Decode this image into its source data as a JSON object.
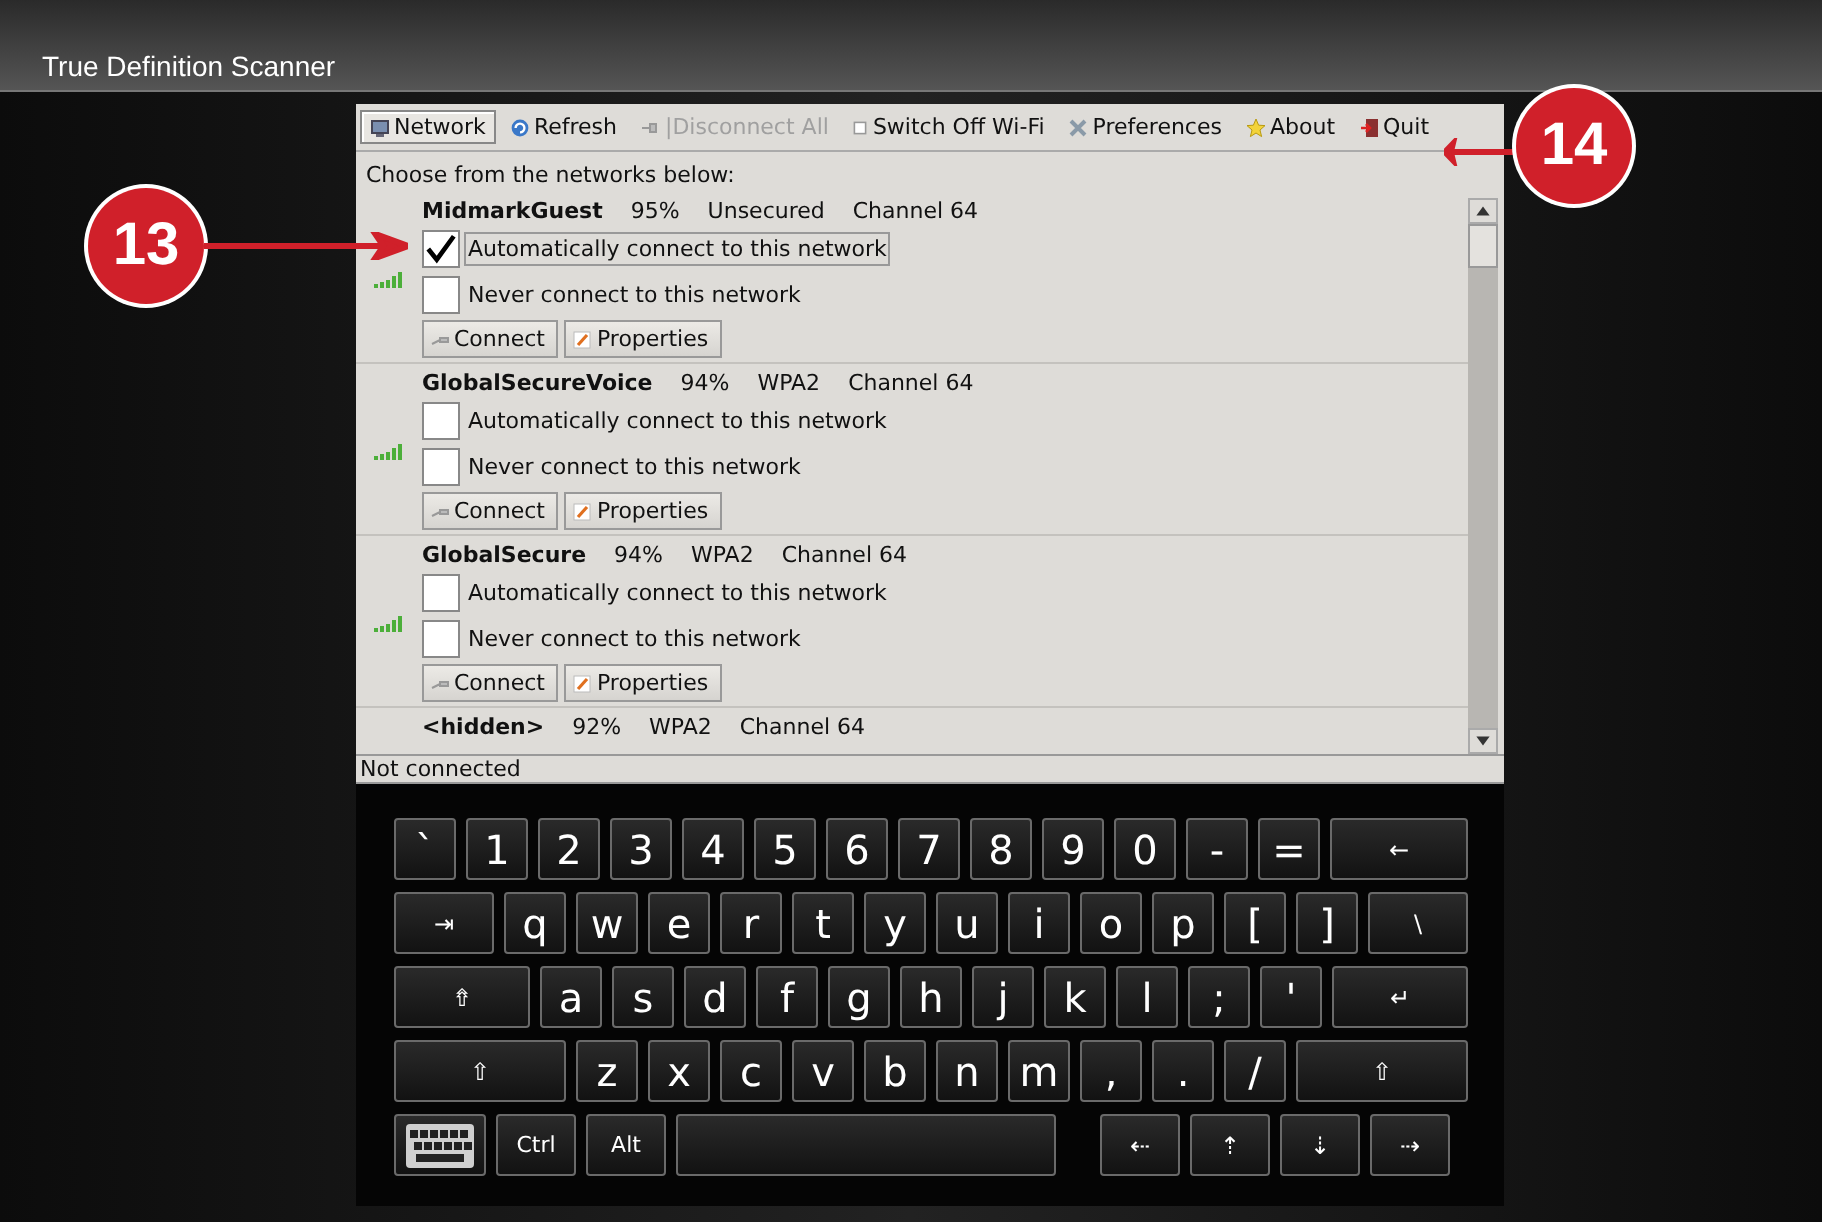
{
  "window": {
    "title": "True Definition Scanner"
  },
  "toolbar": [
    {
      "label": "Network",
      "kind": "network",
      "selected": true,
      "disabled": false
    },
    {
      "label": "Refresh",
      "kind": "refresh",
      "selected": false,
      "disabled": false
    },
    {
      "label": "|Disconnect All",
      "kind": "disconnect",
      "selected": false,
      "disabled": true
    },
    {
      "label": "Switch Off Wi-Fi",
      "kind": "switch",
      "selected": false,
      "disabled": false
    },
    {
      "label": "Preferences",
      "kind": "preferences",
      "selected": false,
      "disabled": false
    },
    {
      "label": "About",
      "kind": "about",
      "selected": false,
      "disabled": false
    },
    {
      "label": "Quit",
      "kind": "quit",
      "selected": false,
      "disabled": false
    }
  ],
  "prompt": "Choose from the networks below:",
  "networks": [
    {
      "name": "MidmarkGuest",
      "strength": "95%",
      "security": "Unsecured",
      "channel": "Channel 64",
      "auto_label": "Automatically connect to this network",
      "auto_checked": true,
      "never_label": "Never connect to this network",
      "never_checked": false,
      "connect": "Connect",
      "properties": "Properties"
    },
    {
      "name": "GlobalSecureVoice",
      "strength": "94%",
      "security": "WPA2",
      "channel": "Channel 64",
      "auto_label": "Automatically connect to this network",
      "auto_checked": false,
      "never_label": "Never connect to this network",
      "never_checked": false,
      "connect": "Connect",
      "properties": "Properties"
    },
    {
      "name": "GlobalSecure",
      "strength": "94%",
      "security": "WPA2",
      "channel": "Channel 64",
      "auto_label": "Automatically connect to this network",
      "auto_checked": false,
      "never_label": "Never connect to this network",
      "never_checked": false,
      "connect": "Connect",
      "properties": "Properties"
    }
  ],
  "partial_network": {
    "name": "<hidden>",
    "strength": "92%",
    "security": "WPA2",
    "channel": "Channel 64"
  },
  "status_bar": "Not connected",
  "keyboard": [
    [
      {
        "label": "`",
        "kind": "char"
      },
      {
        "label": "1",
        "kind": "char"
      },
      {
        "label": "2",
        "kind": "char"
      },
      {
        "label": "3",
        "kind": "char"
      },
      {
        "label": "4",
        "kind": "char"
      },
      {
        "label": "5",
        "kind": "char"
      },
      {
        "label": "6",
        "kind": "char"
      },
      {
        "label": "7",
        "kind": "char"
      },
      {
        "label": "8",
        "kind": "char"
      },
      {
        "label": "9",
        "kind": "char"
      },
      {
        "label": "0",
        "kind": "char"
      },
      {
        "label": "-",
        "kind": "char"
      },
      {
        "label": "=",
        "kind": "char"
      },
      {
        "label": "←",
        "kind": "wide"
      }
    ],
    [
      {
        "label": "⇥",
        "kind": "wide"
      },
      {
        "label": "q",
        "kind": "char"
      },
      {
        "label": "w",
        "kind": "char"
      },
      {
        "label": "e",
        "kind": "char"
      },
      {
        "label": "r",
        "kind": "char"
      },
      {
        "label": "t",
        "kind": "char"
      },
      {
        "label": "y",
        "kind": "char"
      },
      {
        "label": "u",
        "kind": "char"
      },
      {
        "label": "i",
        "kind": "char"
      },
      {
        "label": "o",
        "kind": "char"
      },
      {
        "label": "p",
        "kind": "char"
      },
      {
        "label": "[",
        "kind": "char"
      },
      {
        "label": "]",
        "kind": "char"
      },
      {
        "label": "\\",
        "kind": "wide"
      }
    ],
    [
      {
        "label": "⇮",
        "kind": "wide"
      },
      {
        "label": "a",
        "kind": "char"
      },
      {
        "label": "s",
        "kind": "char"
      },
      {
        "label": "d",
        "kind": "char"
      },
      {
        "label": "f",
        "kind": "char"
      },
      {
        "label": "g",
        "kind": "char"
      },
      {
        "label": "h",
        "kind": "char"
      },
      {
        "label": "j",
        "kind": "char"
      },
      {
        "label": "k",
        "kind": "char"
      },
      {
        "label": "l",
        "kind": "char"
      },
      {
        "label": ";",
        "kind": "char"
      },
      {
        "label": "'",
        "kind": "char"
      },
      {
        "label": "↵",
        "kind": "wide"
      }
    ],
    [
      {
        "label": "⇧",
        "kind": "wide"
      },
      {
        "label": "z",
        "kind": "char"
      },
      {
        "label": "x",
        "kind": "char"
      },
      {
        "label": "c",
        "kind": "char"
      },
      {
        "label": "v",
        "kind": "char"
      },
      {
        "label": "b",
        "kind": "char"
      },
      {
        "label": "n",
        "kind": "char"
      },
      {
        "label": "m",
        "kind": "char"
      },
      {
        "label": ",",
        "kind": "char"
      },
      {
        "label": ".",
        "kind": "char"
      },
      {
        "label": "/",
        "kind": "char"
      },
      {
        "label": "⇧",
        "kind": "wide"
      }
    ],
    [
      {
        "kind": "keyboard"
      },
      {
        "label": "Ctrl",
        "kind": "mod"
      },
      {
        "label": "Alt",
        "kind": "mod"
      },
      {
        "kind": "space"
      },
      {
        "label": "⇠",
        "kind": "arrow"
      },
      {
        "label": "⇡",
        "kind": "arrow"
      },
      {
        "label": "⇣",
        "kind": "arrow"
      },
      {
        "label": "⇢",
        "kind": "arrow"
      }
    ]
  ],
  "callouts": [
    {
      "number": "13"
    },
    {
      "number": "14"
    }
  ]
}
